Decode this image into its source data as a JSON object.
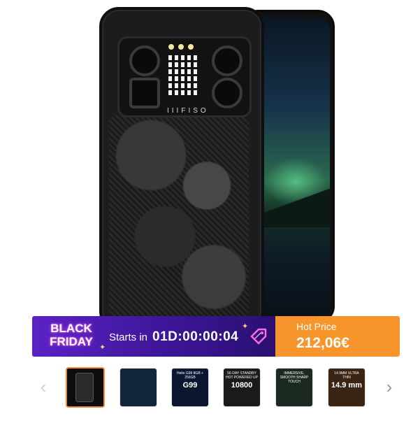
{
  "banner": {
    "event_line1": "BLACK",
    "event_line2": "FRIDAY",
    "starts_label": "Starts in",
    "countdown": "01D:00:00:04"
  },
  "price": {
    "label": "Hot Price",
    "value": "212,06€"
  },
  "product": {
    "brand_mark": "IIIFISO"
  },
  "colors": {
    "banner_purple": "#5b22c5",
    "price_orange": "#f7942b",
    "active_thumb_border": "#f28a3b"
  },
  "thumbnails": [
    {
      "caption": "",
      "big": "",
      "active": true
    },
    {
      "caption": "",
      "big": "",
      "active": false
    },
    {
      "caption": "Helio G99 8GB + 256GB",
      "big": "G99",
      "active": false
    },
    {
      "caption": "56-DAY STANDBY HOT POWERED UP",
      "big": "10800",
      "active": false
    },
    {
      "caption": "IMMERSIVE, SMOOTH SHARP TOUCH",
      "big": "",
      "active": false
    },
    {
      "caption": "14.9MM ULTRA THIN",
      "big": "14.9 mm",
      "active": false
    }
  ],
  "nav": {
    "prev_icon": "chevron-left-icon",
    "next_icon": "chevron-right-icon",
    "prev_glyph": "‹",
    "next_glyph": "›"
  }
}
